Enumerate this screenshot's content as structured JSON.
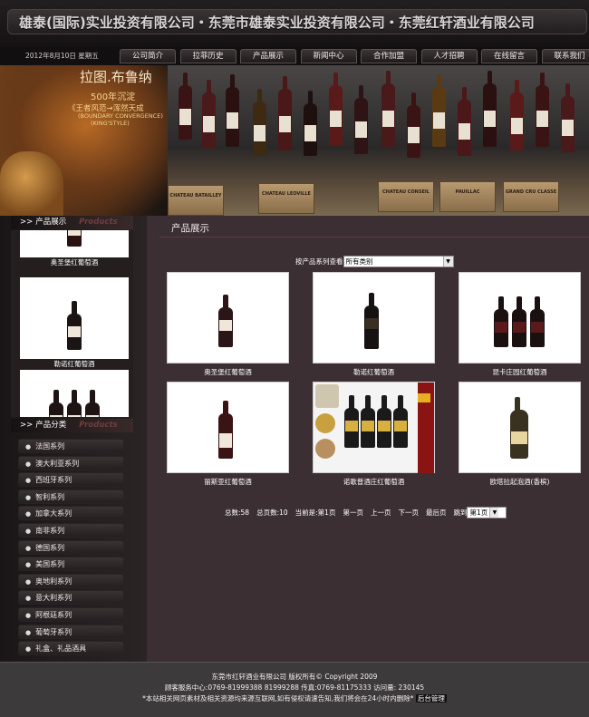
{
  "header": {
    "title": "雄泰(国际)实业投资有限公司・东莞市雄泰实业投资有限公司・东莞红轩酒业有限公司"
  },
  "navbar": {
    "date": "2012年8月10日 星期五",
    "items": [
      "公司简介",
      "拉菲历史",
      "产品展示",
      "新闻中心",
      "合作加盟",
      "人才招聘",
      "在线留言",
      "联系我们"
    ]
  },
  "banner": {
    "line1": "拉图.布鲁纳",
    "line2": "500年沉淀",
    "line3": "《王者风范→浑然天成",
    "line4": "(BOUNDARY CONVERGENCE)",
    "line5": "(KING'STYLE)",
    "crates": [
      "CHATEAU BATAILLEY",
      "CHATEAU LEOVILLE",
      "CHATEAU CONSEIL",
      "PAUILLAC",
      "GRAND CRU CLASSE"
    ]
  },
  "sidebar": {
    "products_heading": "产品展示",
    "products_heading_en": "Products",
    "scroll_items": [
      "奥圣堡红葡萄酒",
      "勒诺红葡萄酒",
      ""
    ],
    "categories_heading": "产品分类",
    "categories_heading_en": "Products",
    "categories": [
      "法国系列",
      "澳大利亚系列",
      "西班牙系列",
      "智利系列",
      "加拿大系列",
      "南非系列",
      "德国系列",
      "美国系列",
      "奥地利系列",
      "意大利系列",
      "阿根廷系列",
      "葡萄牙系列",
      "礼盒、礼品酒具"
    ]
  },
  "main": {
    "title": "产品展示",
    "filter_label": "按产品系列查看",
    "filter_value": "所有类别",
    "products": [
      {
        "name": "奥圣堡红葡萄酒"
      },
      {
        "name": "勒诺红葡萄酒"
      },
      {
        "name": "昆卡庄园红葡萄酒"
      },
      {
        "name": "丽斯亚红葡萄酒"
      },
      {
        "name": "诺歌普酒庄红葡萄酒"
      },
      {
        "name": "欧塔拉起泡酒(香槟)"
      }
    ],
    "pagination": {
      "total": "总数:58",
      "pages": "总页数:10",
      "current": "当前是:第1页",
      "first": "第一页",
      "prev": "上一页",
      "next": "下一页",
      "last": "最后页",
      "jump": "跳到",
      "select_value": "第1页"
    }
  },
  "footer": {
    "line1": "东莞市红轩酒业有限公司 版权所有© Copyright 2009",
    "line2": "顾客服务中心:0769-81999388 81999288 传真:0769-81175333 访问量: 230145",
    "line3": "*本站相关网页素材及相关资源均来源互联网,如有侵权请速告知,我们将会在24小时内删除*",
    "admin": "后台管理"
  },
  "colors": {
    "page_bg": "#1c1819",
    "main_bg": "#3c2f34",
    "footer_bg": "#3d3a3b",
    "heading_en": "#6e3e3e"
  }
}
